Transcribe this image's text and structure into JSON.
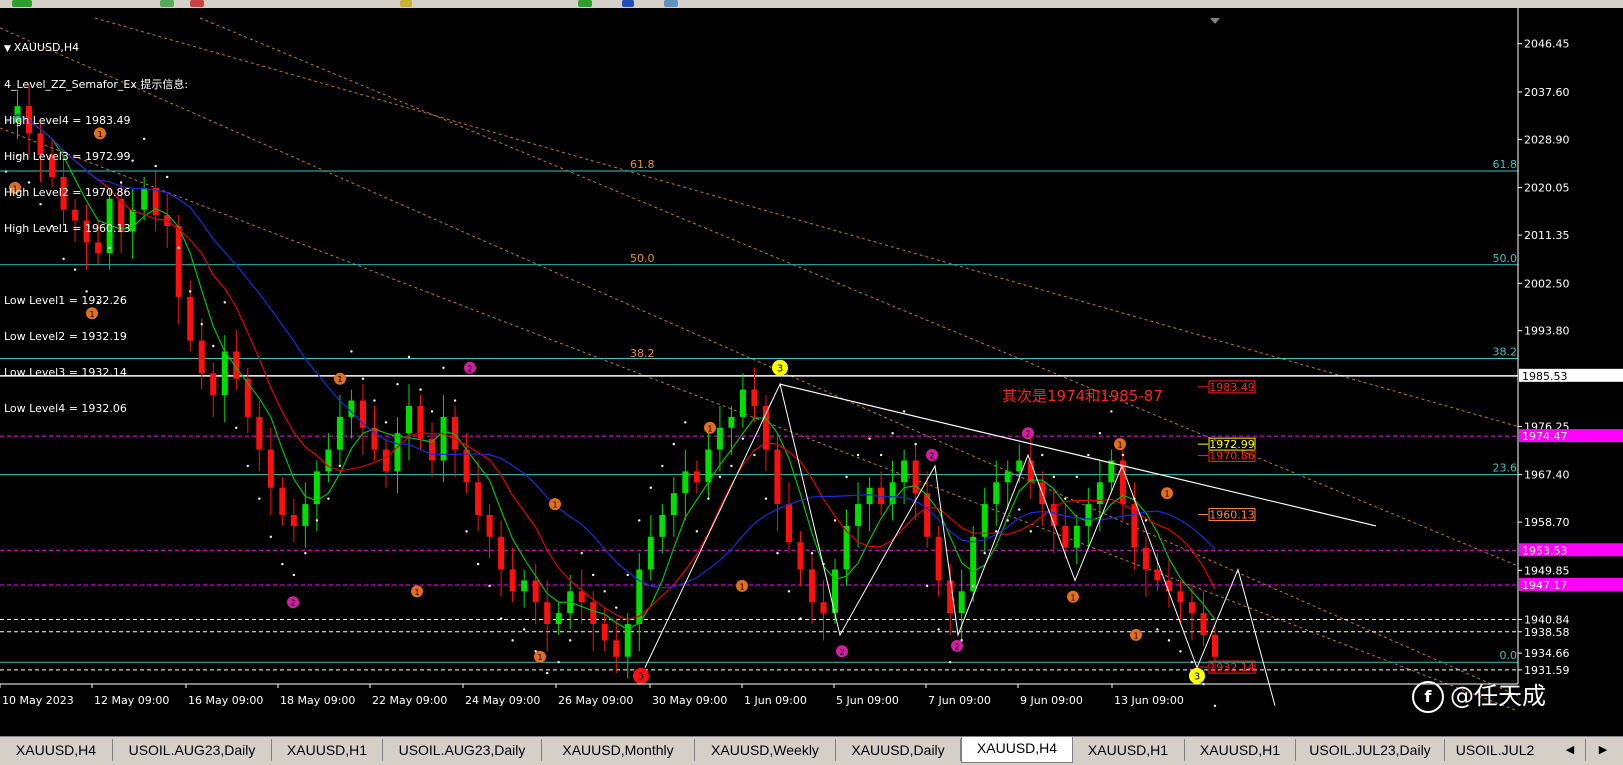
{
  "window": {
    "symbol_title": "XAUUSD,H4"
  },
  "indicator_info": {
    "title": "4_Level_ZZ_Semafor_Ex 提示信息:",
    "lines": [
      "High Level4 = 1983.49",
      "High Level3 = 1972.99",
      "High Level2 = 1970.86",
      "High Level1 = 1960.13",
      "",
      "Low Level1 = 1932.26",
      "Low Level2 = 1932.19",
      "Low Level3 = 1932.14",
      "Low Level4 = 1932.06"
    ]
  },
  "annotation": "其次是1974和1985-87",
  "price_axis": {
    "ticks": [
      "2046.45",
      "2037.60",
      "2028.90",
      "2020.05",
      "2011.35",
      "2002.50",
      "1993.80",
      "1985.53",
      "1976.25",
      "1974.47",
      "1967.40",
      "1958.70",
      "1953.53",
      "1949.85",
      "1947.17",
      "1940.84",
      "1938.58",
      "1934.66",
      "1931.59"
    ],
    "price_min": 1929.0,
    "price_max": 2053.0
  },
  "time_axis": [
    "10 May 2023",
    "12 May 09:00",
    "16 May 09:00",
    "18 May 09:00",
    "22 May 09:00",
    "24 May 09:00",
    "26 May 09:00",
    "30 May 09:00",
    "1 Jun 09:00",
    "5 Jun 09:00",
    "7 Jun 09:00",
    "9 Jun 09:00",
    "13 Jun 09:00"
  ],
  "fibonacci": [
    {
      "label": "61.8",
      "price": 2023.1
    },
    {
      "label": "50.0",
      "price": 2005.9
    },
    {
      "label": "38.2",
      "price": 1988.7
    },
    {
      "label": "23.6",
      "price": 1967.4
    },
    {
      "label": "0.0",
      "price": 1933.0
    }
  ],
  "right_labels": [
    {
      "text": "1983.49",
      "color": "#ff2020",
      "price": 1983.5
    },
    {
      "text": "1972.99",
      "color": "#ffff00",
      "price": 1973.0
    },
    {
      "text": "1970.86",
      "color": "#ff2020",
      "price": 1970.9
    },
    {
      "text": "1960.13",
      "color": "#ff8040",
      "price": 1960.1
    },
    {
      "text": "1932.14",
      "color": "#ff2020",
      "price": 1932.1
    }
  ],
  "colors": {
    "bull": "#00e000",
    "bear": "#ff1010",
    "fib": "#40c0c0",
    "magenta_line": "#ff00ff",
    "ma_fast": "#00c000",
    "ma_mid": "#e00000",
    "ma_slow": "#1e2cd8",
    "semafor1": "#e07020",
    "semafor2": "#d020a0",
    "semafor3": "#ffff00"
  },
  "tabs": [
    {
      "label": "XAUUSD,H4",
      "active": false
    },
    {
      "label": "USOIL.AUG23,Daily",
      "active": false
    },
    {
      "label": "XAUUSD,H1",
      "active": false
    },
    {
      "label": "USOIL.AUG23,Daily",
      "active": false
    },
    {
      "label": "XAUUSD,Monthly",
      "active": false
    },
    {
      "label": "XAUUSD,Weekly",
      "active": false
    },
    {
      "label": "XAUUSD,Daily",
      "active": false
    },
    {
      "label": "XAUUSD,H4",
      "active": true
    },
    {
      "label": "XAUUSD,H1",
      "active": false
    },
    {
      "label": "XAUUSD,H1",
      "active": false
    },
    {
      "label": "USOIL.JUL23,Daily",
      "active": false
    },
    {
      "label": "USOIL.JUL2",
      "active": false
    }
  ],
  "watermark": {
    "icon": "f",
    "text": "@任天成"
  }
}
